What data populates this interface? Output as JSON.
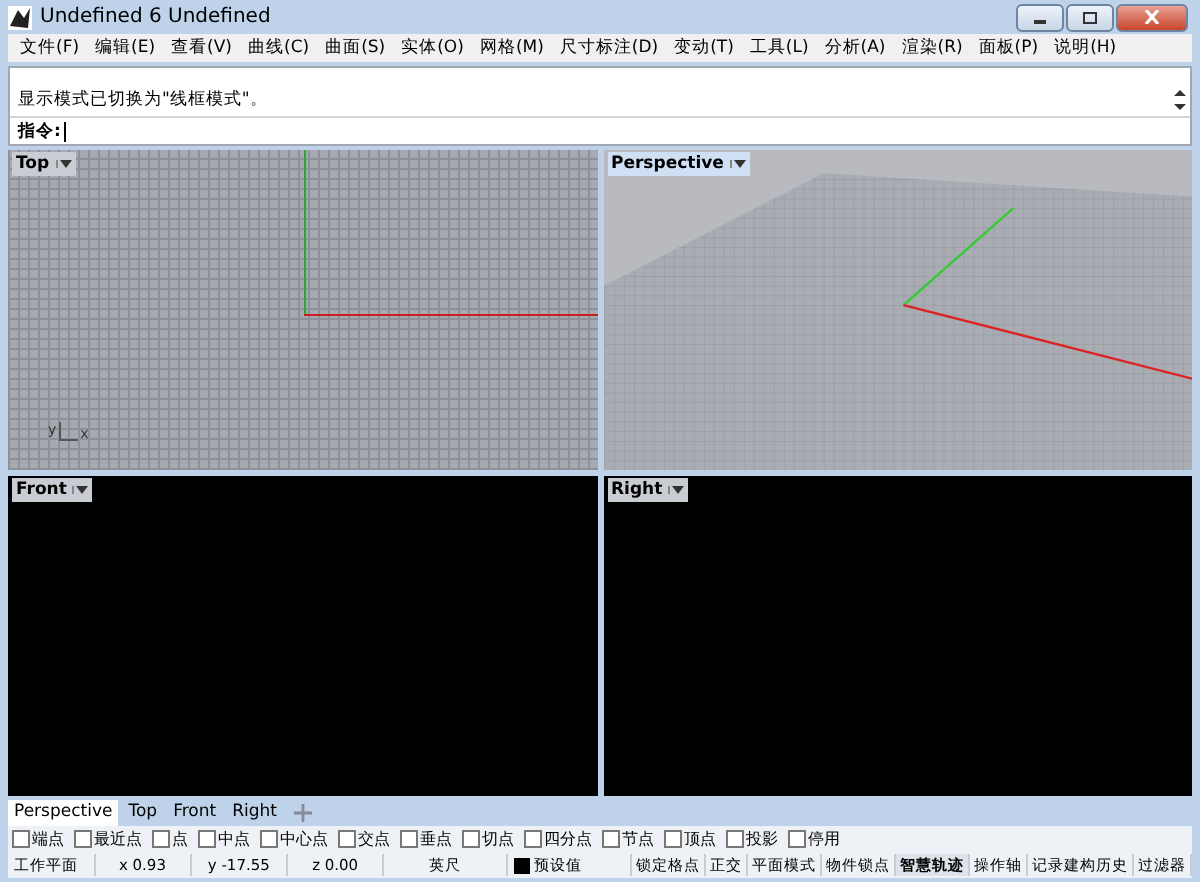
{
  "window": {
    "title": "Undefined 6 Undefined"
  },
  "menu": [
    "文件(F)",
    "编辑(E)",
    "查看(V)",
    "曲线(C)",
    "曲面(S)",
    "实体(O)",
    "网格(M)",
    "尺寸标注(D)",
    "变动(T)",
    "工具(L)",
    "分析(A)",
    "渲染(R)",
    "面板(P)",
    "说明(H)"
  ],
  "command": {
    "history": "显示模式已切换为\"线框模式\"。",
    "prompt": "指令:"
  },
  "viewports": [
    {
      "title": "Top",
      "kind": "grid",
      "active": false,
      "axis_labels": [
        "y",
        "x"
      ]
    },
    {
      "title": "Perspective",
      "kind": "perspective",
      "active": true
    },
    {
      "title": "Front",
      "kind": "dark",
      "active": false
    },
    {
      "title": "Right",
      "kind": "dark",
      "active": false
    }
  ],
  "viewport_tabs": [
    {
      "label": "Perspective",
      "selected": true
    },
    {
      "label": "Top",
      "selected": false
    },
    {
      "label": "Front",
      "selected": false
    },
    {
      "label": "Right",
      "selected": false
    }
  ],
  "osnaps": [
    {
      "label": "端点",
      "checked": false
    },
    {
      "label": "最近点",
      "checked": false
    },
    {
      "label": "点",
      "checked": false
    },
    {
      "label": "中点",
      "checked": false
    },
    {
      "label": "中心点",
      "checked": false
    },
    {
      "label": "交点",
      "checked": false
    },
    {
      "label": "垂点",
      "checked": false
    },
    {
      "label": "切点",
      "checked": false
    },
    {
      "label": "四分点",
      "checked": false
    },
    {
      "label": "节点",
      "checked": false
    },
    {
      "label": "顶点",
      "checked": false
    },
    {
      "label": "投影",
      "checked": false
    },
    {
      "label": "停用",
      "checked": false
    }
  ],
  "status_bar": {
    "plane": "工作平面",
    "x": "x 0.93",
    "y": "y -17.55",
    "z": "z 0.00",
    "unit": "英尺",
    "layer": "预设值",
    "toggles": [
      {
        "label": "锁定格点",
        "on": false
      },
      {
        "label": "正交",
        "on": false
      },
      {
        "label": "平面模式",
        "on": false
      },
      {
        "label": "物件锁点",
        "on": false
      },
      {
        "label": "智慧轨迹",
        "on": true
      },
      {
        "label": "操作轴",
        "on": false
      },
      {
        "label": "记录建构历史",
        "on": false
      },
      {
        "label": "过滤器",
        "on": false
      }
    ]
  }
}
